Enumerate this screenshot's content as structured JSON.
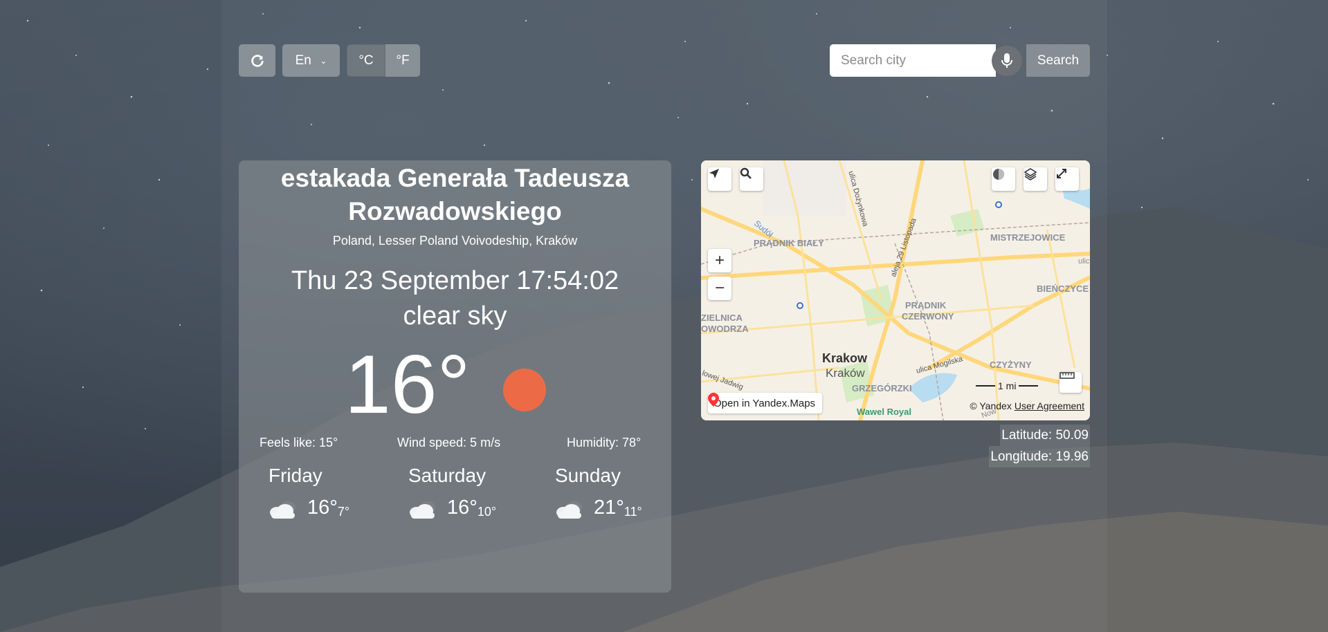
{
  "controls": {
    "language": "En",
    "units": [
      "°C",
      "°F"
    ],
    "search_placeholder": "Search city",
    "search_label": "Search"
  },
  "weather": {
    "city": "estakada Generała Tadeusza Rozwadowskiego",
    "region": "Poland, Lesser Poland Voivodeship, Kraków",
    "datetime": "Thu 23 September 17:54:02",
    "description": "clear sky",
    "temperature": "16°",
    "feels_like": "Feels like: 15°",
    "wind": "Wind speed: 5 m/s",
    "humidity": "Humidity: 78°",
    "forecast": [
      {
        "day": "Friday",
        "hi": "16°",
        "lo": "7°"
      },
      {
        "day": "Saturday",
        "hi": "16°",
        "lo": "10°"
      },
      {
        "day": "Sunday",
        "hi": "21°",
        "lo": "11°"
      }
    ]
  },
  "map": {
    "labels": {
      "pradnik_bialy": "PRĄDNIK BIAŁY",
      "mistrzejowice": "MISTRZEJOWICE",
      "bienczyce": "BIEŃCZYCE",
      "pradnik_czerwony_1": "PRĄDNIK",
      "pradnik_czerwony_2": "CZERWONY",
      "zielnica_1": "ZIELNICA",
      "zielnica_2": "OWODRZA",
      "krakow_1": "Krakow",
      "krakow_2": "Kraków",
      "grzegorzki": "GRZEGÓRZKI",
      "czyzyny": "CZYŻYNY",
      "dozynkowa": "ulica Dożynkowa",
      "listopada": "aleja 29 Listopada",
      "mogilska": "ulica Mogilska",
      "sudol": "Sudół",
      "jadwig": "lowej Jadwig",
      "wawel": "Wawel Royal",
      "ulic": "ulic",
      "now": "Now"
    },
    "scale": "1 mi",
    "open_in": "Open in Yandex.Maps",
    "copyright": "© Yandex",
    "agreement": "User Agreement"
  },
  "coords": {
    "latitude": "Latitude: 50.09",
    "longitude": "Longitude: 19.96"
  },
  "colors": {
    "sun": "#ec6b46",
    "card": "rgba(140,145,150,0.55)"
  }
}
